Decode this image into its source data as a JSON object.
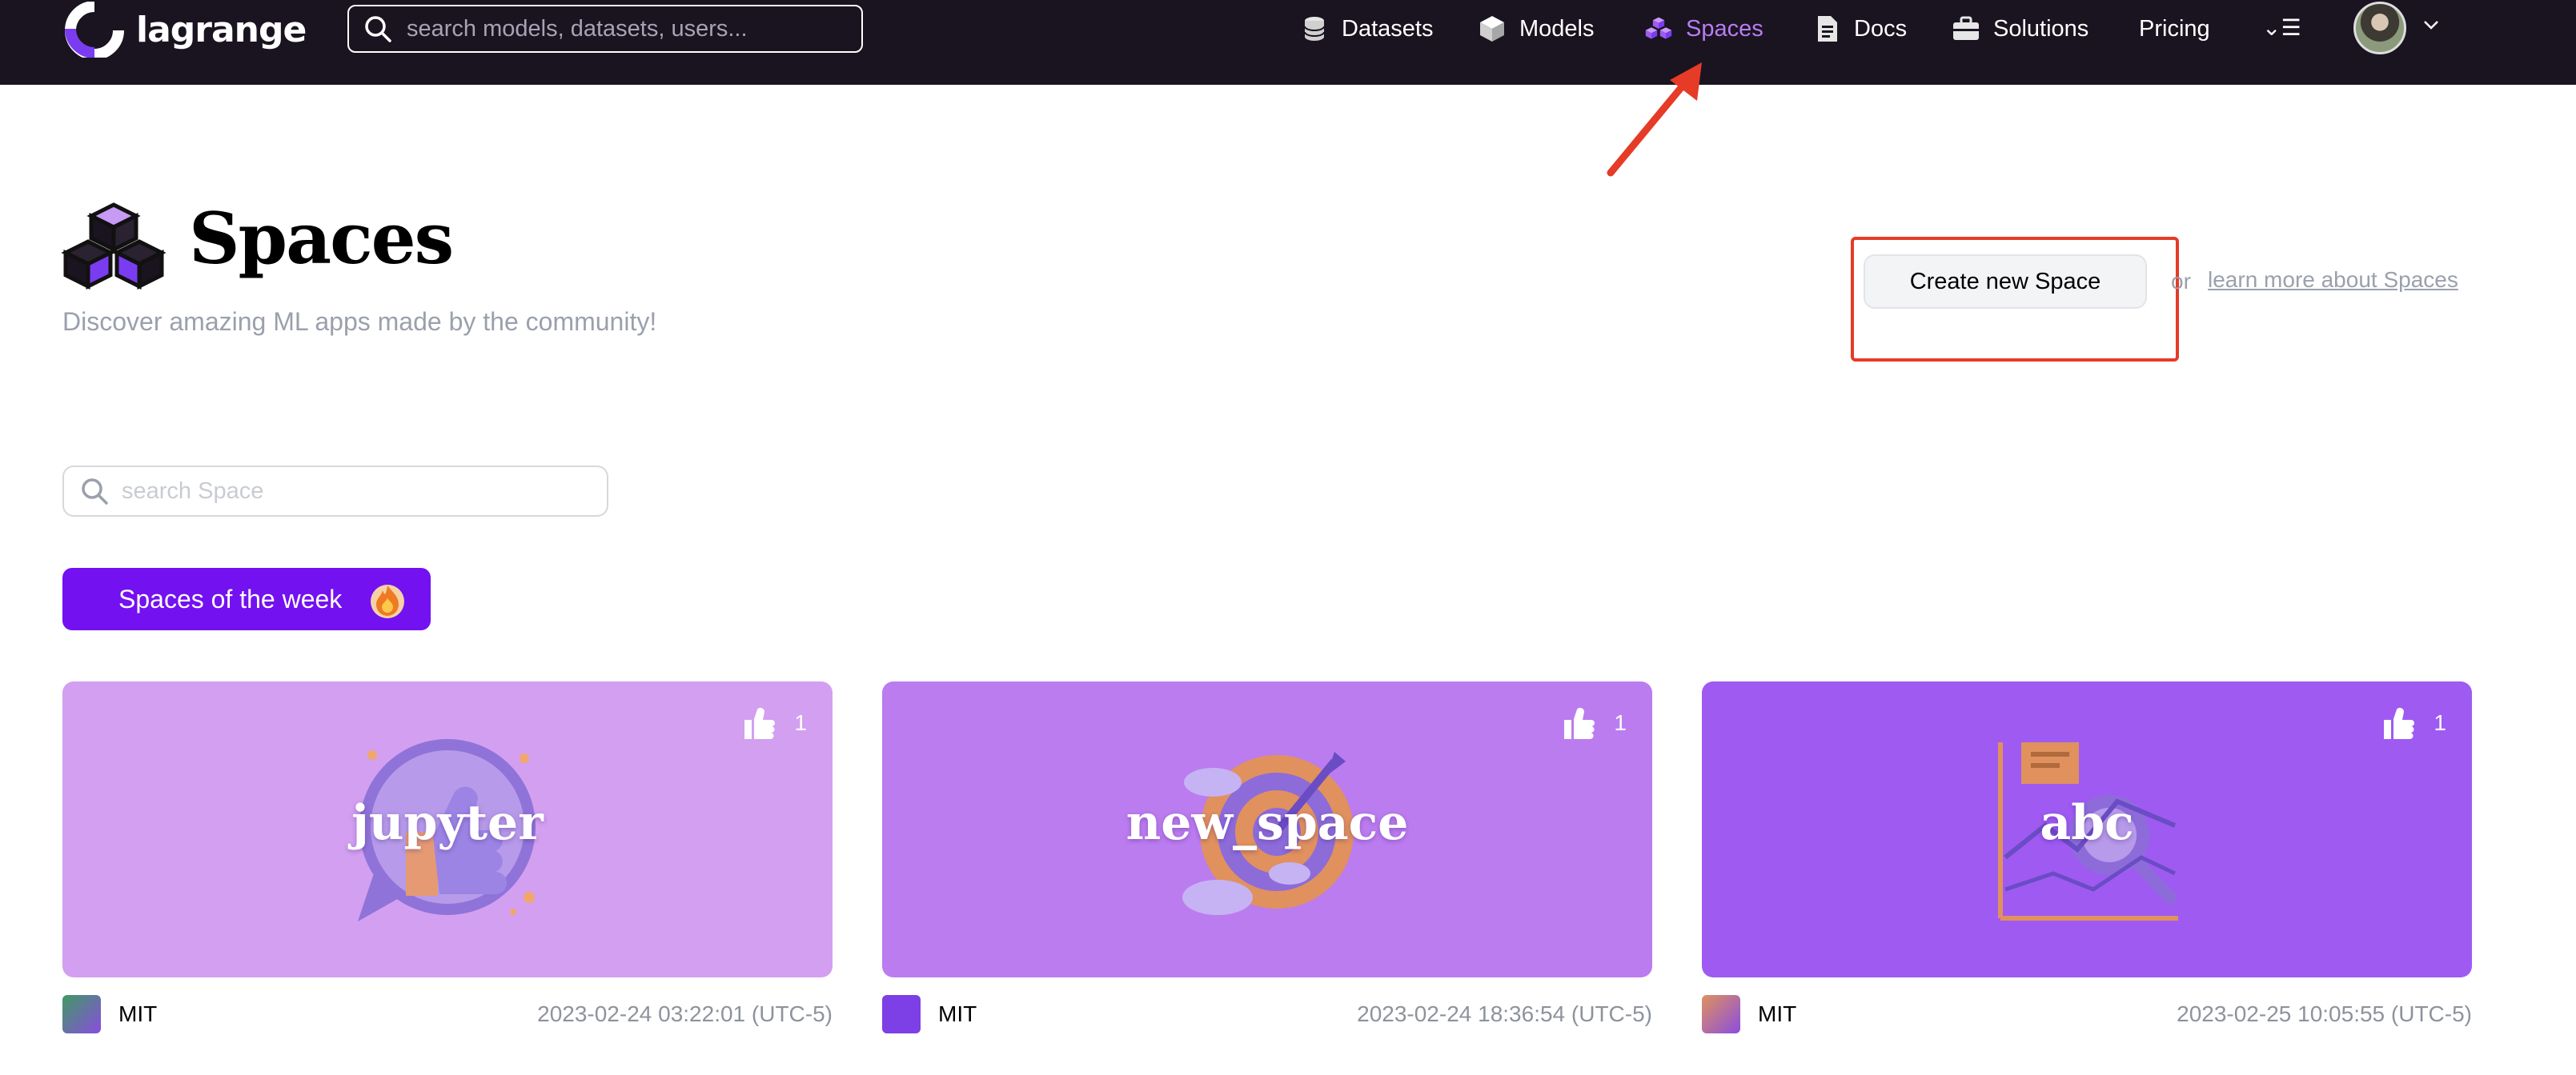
{
  "nav": {
    "brand": "lagrange",
    "search_placeholder": "search models, datasets, users...",
    "items": [
      {
        "label": "Datasets",
        "icon": "database-icon"
      },
      {
        "label": "Models",
        "icon": "cube-icon"
      },
      {
        "label": "Spaces",
        "icon": "spaces-icon",
        "active": true
      },
      {
        "label": "Docs",
        "icon": "document-icon"
      },
      {
        "label": "Solutions",
        "icon": "briefcase-icon"
      },
      {
        "label": "Pricing"
      }
    ],
    "menu_glyph": "⌄☰",
    "active_color": "#b77df2",
    "background": "#1a1320"
  },
  "hero": {
    "title": "Spaces",
    "subtitle": "Discover amazing ML apps made by the community!",
    "create_button": "Create new Space",
    "or_text": "or",
    "learn_link": "learn more about Spaces"
  },
  "search": {
    "placeholder": "search Space"
  },
  "week_button": {
    "label": "Spaces of the week",
    "icon": "fire-icon",
    "color": "#7311f0"
  },
  "cards": [
    {
      "title": "jupyter",
      "likes": "1",
      "license": "MIT",
      "date": "2023-02-24 03:22:01 (UTC-5)",
      "color": "#d39ff0",
      "illustration": "thumbs-up-chat-icon"
    },
    {
      "title": "new_space",
      "likes": "1",
      "license": "MIT",
      "date": "2023-02-24 18:36:54 (UTC-5)",
      "color": "#bb7cef",
      "illustration": "target-dart-icon"
    },
    {
      "title": "abc",
      "likes": "1",
      "license": "MIT",
      "date": "2023-02-25 10:05:55 (UTC-5)",
      "color": "#9f5af2",
      "illustration": "chart-magnifier-icon"
    }
  ]
}
